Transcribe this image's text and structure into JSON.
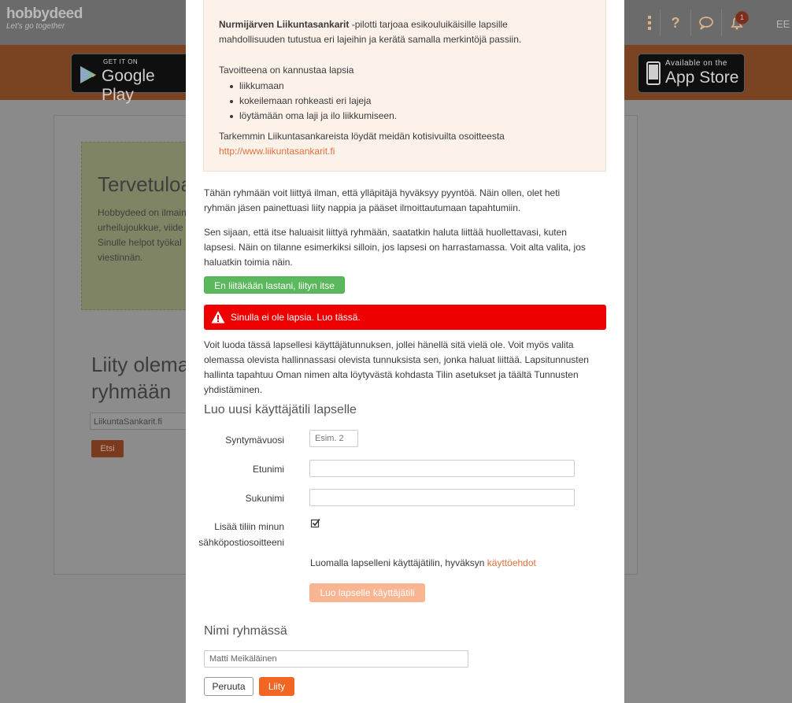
{
  "header": {
    "logo_text": "hobbydeed",
    "logo_tagline": "Let's go together",
    "icons": [
      "more-vertical-icon",
      "help-icon",
      "chat-icon",
      "bell-icon"
    ],
    "notification_count": "1",
    "language": "EE",
    "help_glyph": "?"
  },
  "stores": {
    "google_small": "GET IT ON",
    "google_big": "Google Play",
    "apple_small": "Available on the",
    "apple_big": "App Store"
  },
  "background": {
    "welcome_title": "Tervetuloa",
    "welcome_lines": [
      "Hobbydeed on ilmainen",
      "urheilujoukkue, viide",
      "Sinulle helpot työkal",
      "viestinnän."
    ],
    "join_title_1": "Liity olemassa",
    "join_title_2": "ryhmään",
    "search_value": "LiikuntaSankarit.fi",
    "search_button": "Etsi"
  },
  "info": {
    "bold_name": "Nurmijärven Liikuntasankarit",
    "intro_rest": " -pilotti tarjoaa esikouluikäisille lapsille",
    "intro_line2": "mahdollisuuden tutustua eri lajeihin ja kerätä samalla merkintöjä passiin.",
    "goal_heading": "Tavoitteena on kannustaa lapsia",
    "goals": [
      "liikkumaan",
      "kokeilemaan rohkeasti eri lajeja",
      "löytämään oma laji ja ilo liikkumiseen."
    ],
    "more_line": "Tarkemmin Liikuntasankareista löydät meidän kotisivuilta osoitteesta",
    "link": "http://www.liikuntasankarit.fi"
  },
  "text": {
    "para1_l1": "Tähän ryhmään voit liittyä ilman, että ylläpitäjä hyväksyy pyyntöä. Näin ollen, olet heti",
    "para1_l2": "ryhmän jäsen painettuasi liity nappia ja pääset ilmoittautumaan tapahtumiin.",
    "para2_l1": "Sen sijaan, että itse haluaisit liittyä ryhmään, saatatkin haluta liittää huollettavasi, kuten",
    "para2_l2": "lapsesi. Näin on tilanne esimerkiksi silloin, jos lapsesi on harrastamassa. Voit alta valita, jos",
    "para2_l3": "haluatkin toimia näin.",
    "self_join_button": "En liitäkään lastani, liityn itse",
    "alert": "Sinulla ei ole lapsia. Luo tässä.",
    "para3_l1": "Voit luoda tässä lapsellesi käyttäjätunnuksen, jollei hänellä sitä vielä ole. Voit myös valita",
    "para3_l2": "olemassa olevista hallinnassasi olevista tunnuksista sen, jonka haluat liittää. Lapsitunnusten",
    "para3_l3": "hallinta tapahtuu Oman nimen alta löytyvästä kohdasta Tilin asetukset ja täältä Tunnusten",
    "para3_l4": "yhdistäminen."
  },
  "form": {
    "title": "Luo uusi käyttäjätili lapselle",
    "birth_year_label": "Syntymävuosi",
    "birth_year_placeholder": "Esim. 2",
    "first_name_label": "Etunimi",
    "last_name_label": "Sukunimi",
    "email_label_1": "Lisää tiliin minun",
    "email_label_2": "sähköpostiosoitteeni",
    "email_checked": true,
    "terms_text": "Luomalla lapselleni käyttäjätilin, hyväksyn ",
    "terms_link": "käyttöehdot",
    "create_button": "Luo lapselle käyttäjätili"
  },
  "group": {
    "title": "Nimi ryhmässä",
    "name_value": "Matti Meikäläinen",
    "cancel_button": "Peruuta",
    "join_button": "Liity"
  },
  "colors": {
    "accent": "#f26522",
    "link": "#e0703a",
    "success": "#5cb85c",
    "danger": "#ee0000",
    "info_bg": "#fdf2ea"
  }
}
